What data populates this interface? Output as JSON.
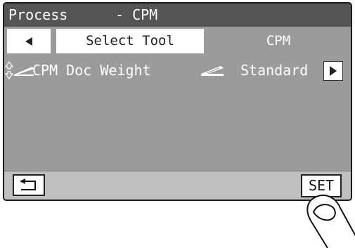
{
  "title": {
    "screen": "Process",
    "separator": "- CPM"
  },
  "tabs": {
    "prev_icon": "left-triangle-icon",
    "select_tool_label": "Select Tool",
    "cpm_label": "CPM"
  },
  "setting_row": {
    "label": "CPM Doc Weight",
    "value": "Standard",
    "next_icon": "right-triangle-icon"
  },
  "bottom": {
    "back_icon": "return-arrow-icon",
    "set_label": "SET"
  },
  "colors": {
    "screen_bg": "#9b9b9b",
    "title_bg": "#555555",
    "bottom_bg": "#bfbfbf"
  }
}
